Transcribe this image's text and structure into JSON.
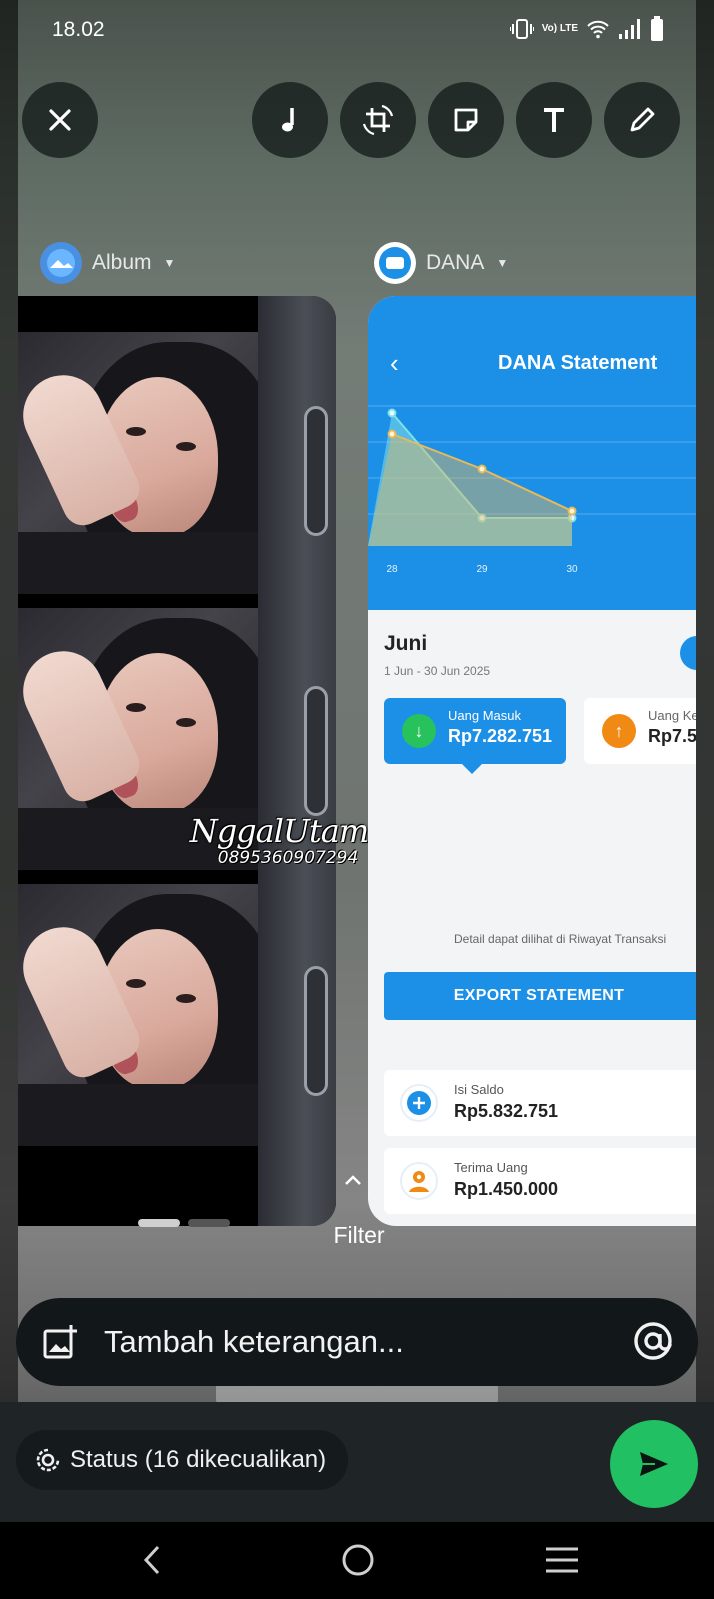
{
  "status_bar": {
    "time": "18.02",
    "volte_label": "Vo) LTE"
  },
  "toolbar": {
    "buttons": [
      "close-icon",
      "music-icon",
      "crop-rotate-icon",
      "sticker-icon",
      "text-icon",
      "pencil-icon"
    ]
  },
  "sources": {
    "left": {
      "label": "Album"
    },
    "right": {
      "label": "DANA"
    }
  },
  "album_preview": {
    "watermark_name": "NggalUtama",
    "watermark_phone": "0895360907294"
  },
  "dana_preview": {
    "title": "DANA Statement",
    "back_symbol": "‹",
    "chart_data": {
      "type": "line",
      "categories": [
        "28",
        "29",
        "30"
      ],
      "series": [
        {
          "values": [
            95,
            20,
            20
          ],
          "color": "#7fe0e8"
        },
        {
          "values": [
            80,
            55,
            25
          ],
          "color": "#e7b95a"
        }
      ]
    },
    "month": "Juni",
    "range": "1 Jun - 30 Jun 2025",
    "tiles": [
      {
        "label": "Uang Masuk",
        "amount": "Rp7.282.751",
        "icon": "arrow-down-icon",
        "color": "#27c25c"
      },
      {
        "label": "Uang Keluar",
        "amount": "Rp7.5",
        "icon": "arrow-up-icon",
        "color": "#f08a14"
      }
    ],
    "rows": [
      {
        "label": "Isi Saldo",
        "amount": "Rp5.832.751",
        "icon": "plus-circle-icon"
      },
      {
        "label": "Terima Uang",
        "amount": "Rp1.450.000",
        "icon": "receive-money-icon"
      }
    ],
    "note": "Detail dapat dilihat di Riwayat Transaksi",
    "export_label": "EXPORT STATEMENT"
  },
  "filter": {
    "label": "Filter"
  },
  "caption": {
    "placeholder": "Tambah keterangan..."
  },
  "status_selector": {
    "label": "Status (16 dikecualikan)"
  },
  "colors": {
    "whatsapp_green": "#21c063",
    "dana_blue": "#1c8fe7"
  }
}
